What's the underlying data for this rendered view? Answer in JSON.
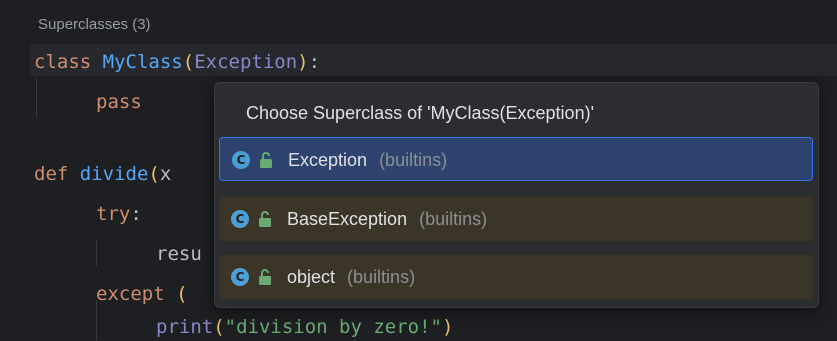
{
  "editor": {
    "hint": "Superclasses (3)",
    "lines": {
      "l1": {
        "kw": "class",
        "name": "MyClass",
        "open": "(",
        "base": "Exception",
        "close": ")",
        "colon": ":"
      },
      "l2": {
        "kw": "pass"
      },
      "l3": {
        "kw": "def",
        "name": "divide",
        "open": "(",
        "rest": "x"
      },
      "l4": {
        "kw": "try",
        "colon": ":"
      },
      "l5": {
        "text": "resu"
      },
      "l6": {
        "kw": "except",
        "open": "("
      },
      "l7": {
        "fn": "print",
        "open": "(",
        "str": "\"division by zero!\"",
        "close": ")"
      }
    }
  },
  "popup": {
    "title": "Choose Superclass of 'MyClass(Exception)'",
    "items": [
      {
        "icon": "class-icon",
        "badge": "C",
        "name": "Exception",
        "location": "(builtins)",
        "selected": true
      },
      {
        "icon": "class-icon",
        "badge": "C",
        "name": "BaseException",
        "location": "(builtins)",
        "selected": false
      },
      {
        "icon": "class-icon",
        "badge": "C",
        "name": "object",
        "location": "(builtins)",
        "selected": false
      }
    ]
  },
  "colors": {
    "background": "#1e1f22",
    "keyword": "#cf8e6d",
    "class_name": "#56a8f5",
    "builtin": "#8888c6",
    "string": "#6aab73",
    "selection": "#2e436e",
    "accent": "#3574f0"
  }
}
